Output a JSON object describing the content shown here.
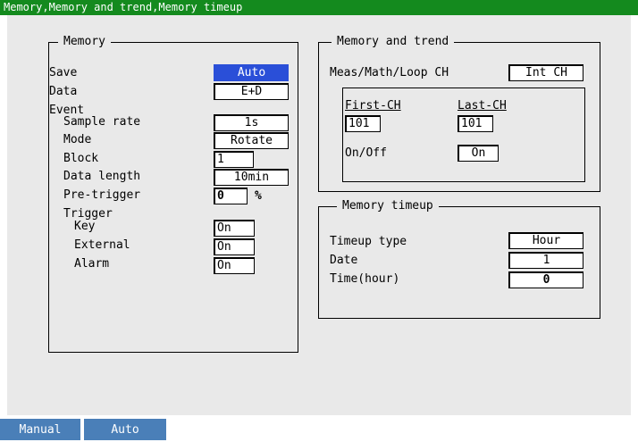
{
  "title": "Memory,Memory and trend,Memory timeup",
  "memory": {
    "heading": "Memory",
    "save_label": "Save",
    "save_value": "Auto",
    "data_label": "Data",
    "data_value": "E+D",
    "event_label": "Event",
    "sample_rate_label": "Sample rate",
    "sample_rate_value": "1s",
    "mode_label": "Mode",
    "mode_value": "Rotate",
    "block_label": "Block",
    "block_value": "1",
    "data_length_label": "Data length",
    "data_length_value": "10min",
    "pre_trigger_label": "Pre-trigger",
    "pre_trigger_value": "0",
    "pre_trigger_unit": "%",
    "trigger_label": "Trigger",
    "key_label": "Key",
    "key_value": "On",
    "external_label": "External",
    "external_value": "On",
    "alarm_label": "Alarm",
    "alarm_value": "On"
  },
  "memory_trend": {
    "heading": "Memory and trend",
    "ch_label": "Meas/Math/Loop CH",
    "ch_value": "Int CH",
    "first_ch_label": "First-CH",
    "first_ch_value": "101",
    "last_ch_label": "Last-CH",
    "last_ch_value": "101",
    "onoff_label": "On/Off",
    "onoff_value": "On"
  },
  "timeup": {
    "heading": "Memory timeup",
    "type_label": "Timeup type",
    "type_value": "Hour",
    "date_label": "Date",
    "date_value": "1",
    "time_label": "Time(hour)",
    "time_value": "0"
  },
  "softkeys": [
    "Manual",
    "Auto"
  ],
  "colors": {
    "title_bar": "#148a1e",
    "selected_field": "#2a4fd8",
    "softkey": "#4a7fb8",
    "panel": "#e9e9e9"
  }
}
